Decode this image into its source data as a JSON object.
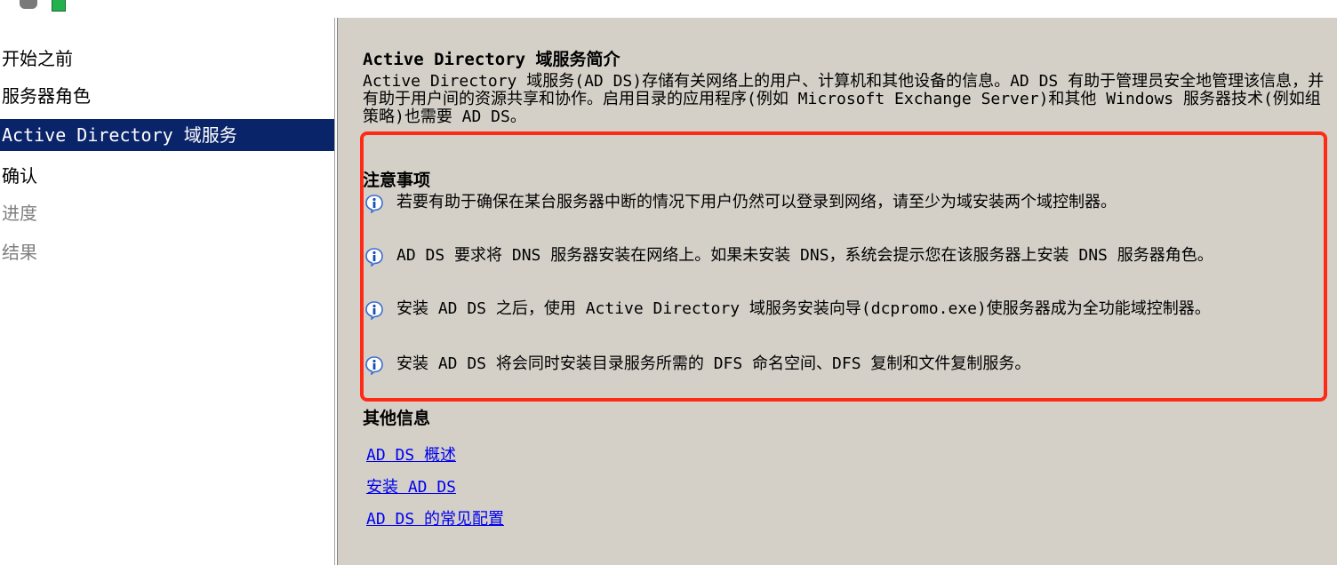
{
  "nav": {
    "items": [
      {
        "label": "开始之前",
        "state": "normal"
      },
      {
        "label": "服务器角色",
        "state": "normal"
      },
      {
        "label": "Active Directory 域服务",
        "state": "selected"
      },
      {
        "label": "确认",
        "state": "normal"
      },
      {
        "label": "进度",
        "state": "disabled"
      },
      {
        "label": "结果",
        "state": "disabled"
      }
    ]
  },
  "main": {
    "title": "Active Directory 域服务简介",
    "intro": "Active Directory 域服务(AD DS)存储有关网络上的用户、计算机和其他设备的信息。AD DS 有助于管理员安全地管理该信息，并有助于用户间的资源共享和协作。启用目录的应用程序(例如 Microsoft Exchange Server)和其他 Windows 服务器技术(例如组策略)也需要 AD DS。",
    "notes_heading": "注意事项",
    "notes": [
      "若要有助于确保在某台服务器中断的情况下用户仍然可以登录到网络，请至少为域安装两个域控制器。",
      "AD DS 要求将 DNS 服务器安装在网络上。如果未安装 DNS，系统会提示您在该服务器上安装 DNS 服务器角色。",
      "安装 AD DS 之后，使用 Active Directory 域服务安装向导(dcpromo.exe)使服务器成为全功能域控制器。",
      "安装 AD DS 将会同时安装目录服务所需的 DFS 命名空间、DFS 复制和文件复制服务。"
    ],
    "more_heading": "其他信息",
    "links": [
      "AD DS 概述",
      "安装 AD DS",
      "AD DS 的常见配置"
    ]
  },
  "colors": {
    "selection": "#0a246a",
    "highlight_border": "#ff2a16",
    "link": "#0000ee",
    "panel_bg": "#d4d0c8"
  },
  "icons": {
    "note_icon": "info-icon"
  }
}
